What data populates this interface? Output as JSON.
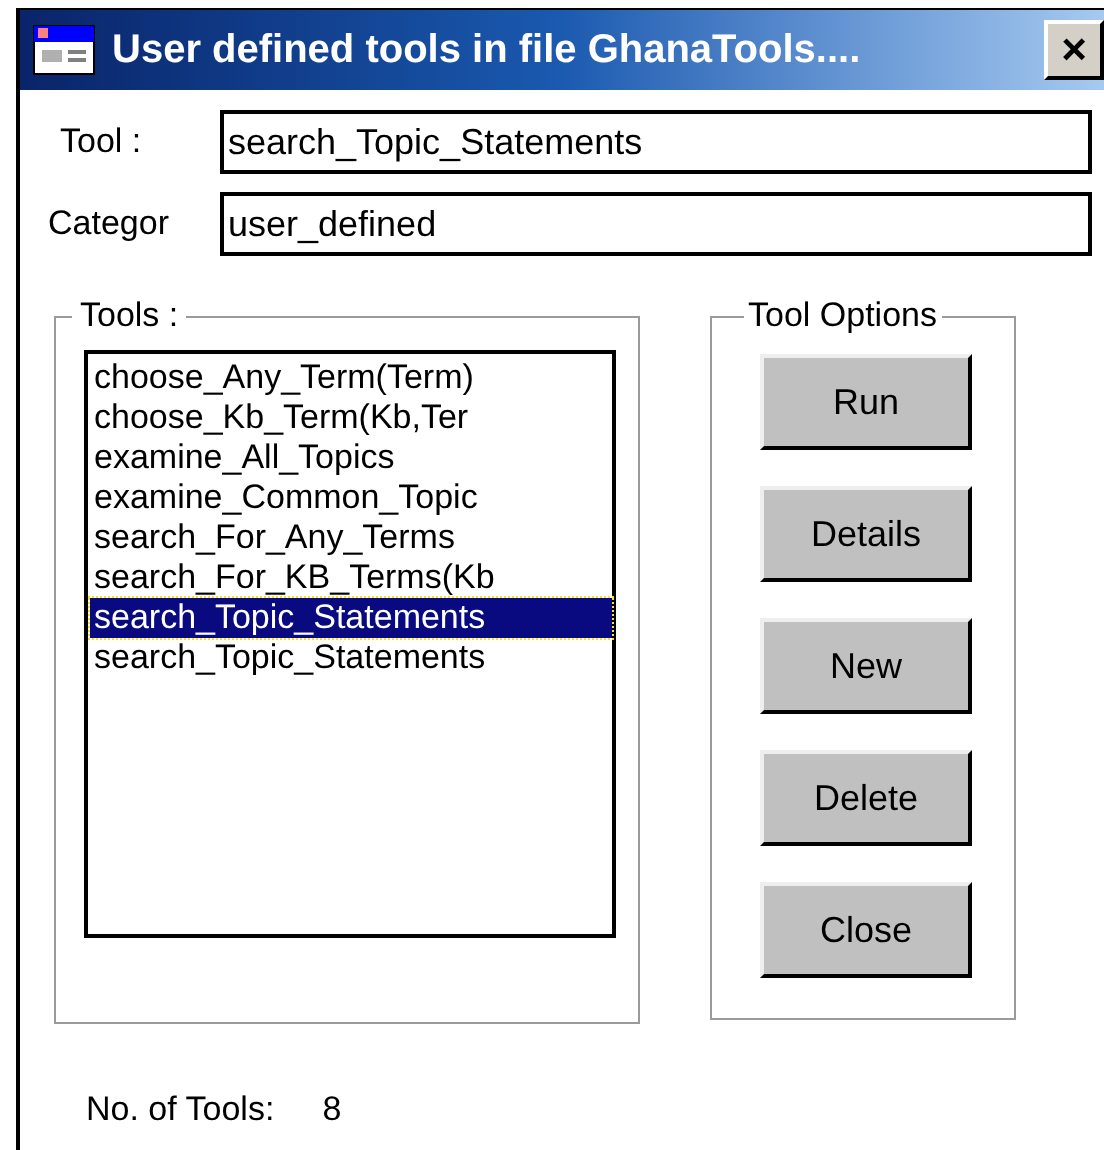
{
  "window": {
    "title": "User defined tools in file GhanaTools....",
    "close": "×"
  },
  "fields": [
    {
      "label": "Tool :",
      "value": "search_Topic_Statements"
    },
    {
      "label": "Categor",
      "value": "user_defined"
    }
  ],
  "tools_group": {
    "title": "Tools :",
    "items": [
      {
        "label": "choose_Any_Term(Term)",
        "selected": false
      },
      {
        "label": "choose_Kb_Term(Kb,Ter",
        "selected": false
      },
      {
        "label": "examine_All_Topics",
        "selected": false
      },
      {
        "label": "examine_Common_Topic",
        "selected": false
      },
      {
        "label": "search_For_Any_Terms",
        "selected": false
      },
      {
        "label": "search_For_KB_Terms(Kb",
        "selected": false
      },
      {
        "label": "search_Topic_Statements",
        "selected": true
      },
      {
        "label": "search_Topic_Statements",
        "selected": false
      }
    ]
  },
  "options_group": {
    "title": "Tool Options",
    "buttons": [
      "Run",
      "Details",
      "New",
      "Delete",
      "Close"
    ]
  },
  "status": {
    "label": "No. of Tools:",
    "count": "8"
  }
}
